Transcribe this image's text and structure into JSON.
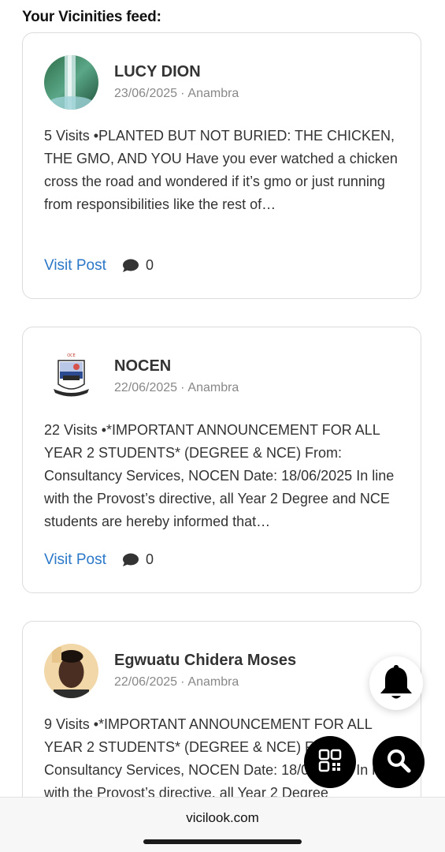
{
  "feed": {
    "heading": "Your Vicinities feed:"
  },
  "posts": [
    {
      "author": "LUCY DION",
      "date": "23/06/2025",
      "separator": "·",
      "location": "Anambra",
      "excerpt": "5 Visits •PLANTED BUT NOT BURIED: THE CHICKEN, THE GMO, AND YOU Have you ever watched a chicken cross the road and wondered if it’s gmo or just running from responsibilities like the rest of…",
      "visit_label": "Visit Post",
      "comment_count": "0"
    },
    {
      "author": "NOCEN",
      "date": "22/06/2025",
      "separator": "·",
      "location": "Anambra",
      "excerpt": "22 Visits •*IMPORTANT ANNOUNCEMENT FOR ALL YEAR 2 STUDENTS* (DEGREE & NCE) From: Consultancy Services, NOCEN Date: 18/06/2025 In line with the Provost’s directive, all Year 2 Degree and NCE students are hereby informed that…",
      "visit_label": "Visit Post",
      "comment_count": "0",
      "logo_text": "EXCELLENCE IN KNOWLEDGE"
    },
    {
      "author": "Egwuatu Chidera Moses",
      "date": "22/06/2025",
      "separator": "·",
      "location": "Anambra",
      "excerpt": "9 Visits •*IMPORTANT ANNOUNCEMENT FOR ALL YEAR 2 STUDENTS* (DEGREE & NCE) From: Consultancy Services, NOCEN Date: 18/06/2025 In line with the Provost’s directive, all Year 2 Degree"
    }
  ],
  "browser": {
    "url": "vicilook.com"
  },
  "icons": {
    "bell": "bell-icon",
    "qr": "qr-code-icon",
    "search": "search-icon",
    "comment": "comment-icon"
  },
  "colors": {
    "link": "#2b77c8",
    "fab": "#000000"
  }
}
